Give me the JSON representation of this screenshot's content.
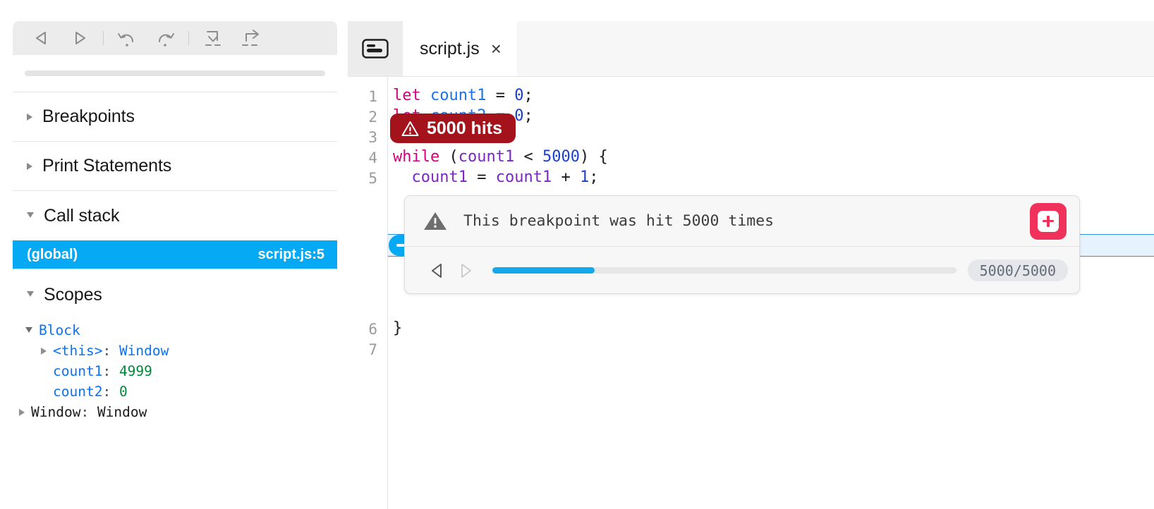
{
  "debugger_toolbar": {
    "buttons": [
      {
        "name": "step-back-button",
        "icon": "triangle-left-icon"
      },
      {
        "name": "resume-button",
        "icon": "triangle-right-icon"
      },
      {
        "name": "step-over-back-button",
        "icon": "curved-arrow-left-icon"
      },
      {
        "name": "step-over-button",
        "icon": "curved-arrow-right-icon"
      },
      {
        "name": "step-into-button",
        "icon": "arrow-down-into-icon"
      },
      {
        "name": "step-out-button",
        "icon": "arrow-up-out-icon"
      }
    ],
    "filter_placeholder": ""
  },
  "sidebar": {
    "sections": [
      {
        "label": "Breakpoints",
        "expanded": false
      },
      {
        "label": "Print Statements",
        "expanded": false
      },
      {
        "label": "Call stack",
        "expanded": true
      }
    ],
    "call_stack": [
      {
        "frame": "(global)",
        "location": "script.js:5",
        "selected": true
      }
    ],
    "scopes_label": "Scopes",
    "scopes": [
      {
        "label": "Block",
        "expanded": true,
        "depth": 0,
        "style": "blue-key"
      },
      {
        "key": "<this>",
        "value": "Window",
        "depth": 1,
        "expandable": true,
        "value_style": "blue"
      },
      {
        "key": "count1",
        "value": "4999",
        "depth": 2,
        "expandable": false,
        "value_style": "green"
      },
      {
        "key": "count2",
        "value": "0",
        "depth": 2,
        "expandable": false,
        "value_style": "green"
      },
      {
        "key": "Window",
        "value": "Window",
        "depth": 0,
        "expandable": true,
        "value_style": "dark",
        "key_style": "dark"
      }
    ]
  },
  "editor": {
    "sidebar_toggle_icon": "panel-toggle-icon",
    "tab": {
      "label": "script.js",
      "close_label": "×"
    },
    "line_numbers": [
      "1",
      "2",
      "3",
      "4",
      "5",
      "6",
      "7"
    ],
    "lines": [
      [
        {
          "t": "let",
          "c": "kw"
        },
        {
          "t": " ",
          "c": "op"
        },
        {
          "t": "count1",
          "c": "var"
        },
        {
          "t": " = ",
          "c": "op"
        },
        {
          "t": "0",
          "c": "num"
        },
        {
          "t": ";",
          "c": "op"
        }
      ],
      [
        {
          "t": "let",
          "c": "kw"
        },
        {
          "t": " ",
          "c": "op"
        },
        {
          "t": "count2",
          "c": "var"
        },
        {
          "t": " = ",
          "c": "op"
        },
        {
          "t": "0",
          "c": "num"
        },
        {
          "t": ";",
          "c": "op"
        }
      ],
      [],
      [
        {
          "t": "while",
          "c": "kw"
        },
        {
          "t": " (",
          "c": "op"
        },
        {
          "t": "count1",
          "c": "varp"
        },
        {
          "t": " < ",
          "c": "op"
        },
        {
          "t": "5000",
          "c": "num"
        },
        {
          "t": ") {",
          "c": "op"
        }
      ],
      [
        {
          "t": "  ",
          "c": "op"
        },
        {
          "t": "count1",
          "c": "varp"
        },
        {
          "t": " = ",
          "c": "op"
        },
        {
          "t": "count1",
          "c": "varp"
        },
        {
          "t": " + ",
          "c": "op"
        },
        {
          "t": "1",
          "c": "num"
        },
        {
          "t": ";",
          "c": "op"
        }
      ],
      [
        {
          "t": "}",
          "c": "op"
        }
      ],
      []
    ],
    "active_line": 5,
    "breakpoint_line": 5,
    "hits_badge": {
      "label": "5000 hits",
      "icon": "warning-triangle-icon",
      "color": "#A4121C"
    }
  },
  "popover": {
    "icon": "warning-triangle-filled-icon",
    "message": "This breakpoint was hit 5000 times",
    "add_button": {
      "name": "add-action-button",
      "icon": "plus-in-square-icon",
      "color": "#F0315B"
    },
    "prev_label": "previous-hit",
    "next_label": "next-hit",
    "progress_percent": 22,
    "counter": "5000/5000",
    "progress_color": "#13A8E8"
  }
}
